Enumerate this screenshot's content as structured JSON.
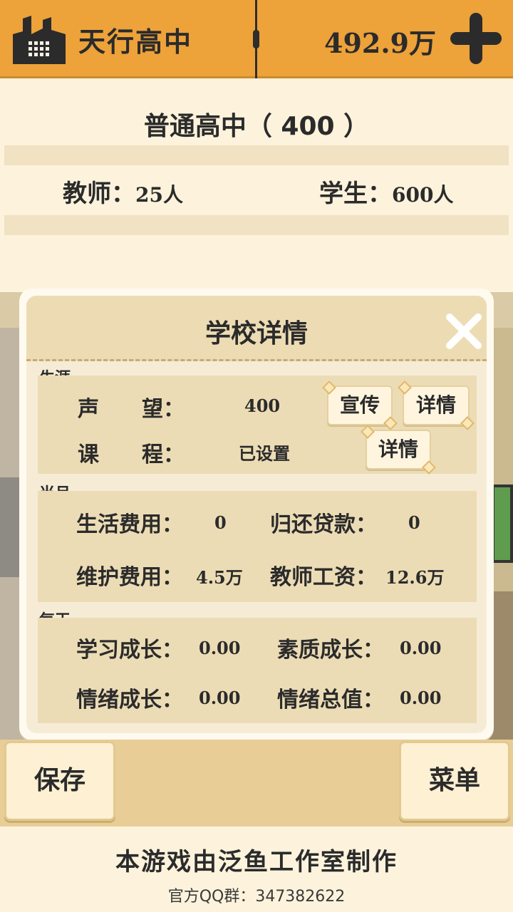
{
  "header": {
    "school_name": "天行高中",
    "money": "492.9万"
  },
  "info": {
    "school_type": "普通高中（ 400 ）",
    "teacher_label": "教师：",
    "teacher_value": "25人",
    "student_label": "学生：",
    "student_value": "600人"
  },
  "dialog": {
    "title": "学校详情",
    "career": {
      "label": "生涯",
      "reputation_label": "声　　望：",
      "reputation_value": "400",
      "promote_button": "宣传",
      "reputation_detail_button": "详情",
      "course_label": "课　　程：",
      "course_value": "已设置",
      "course_detail_button": "详情"
    },
    "monthly": {
      "label": "当月",
      "living_cost_label": "生活费用：",
      "living_cost_value": "0",
      "loan_label": "归还贷款：",
      "loan_value": "0",
      "maintenance_label": "维护费用：",
      "maintenance_value": "4.5万",
      "salary_label": "教师工资：",
      "salary_value": "12.6万"
    },
    "daily": {
      "label": "每天",
      "study_label": "学习成长：",
      "study_value": "0.00",
      "quality_label": "素质成长：",
      "quality_value": "0.00",
      "mood_growth_label": "情绪成长：",
      "mood_growth_value": "0.00",
      "mood_total_label": "情绪总值：",
      "mood_total_value": "0.00"
    }
  },
  "bottom": {
    "save_button": "保存",
    "menu_button": "菜单"
  },
  "footer": {
    "credit": "本游戏由泛鱼工作室制作",
    "qq": "官方QQ群：347382622"
  },
  "colors": {
    "topbar": "#eda23a",
    "panel": "#fdf3dc",
    "section": "#ecdcb5"
  }
}
